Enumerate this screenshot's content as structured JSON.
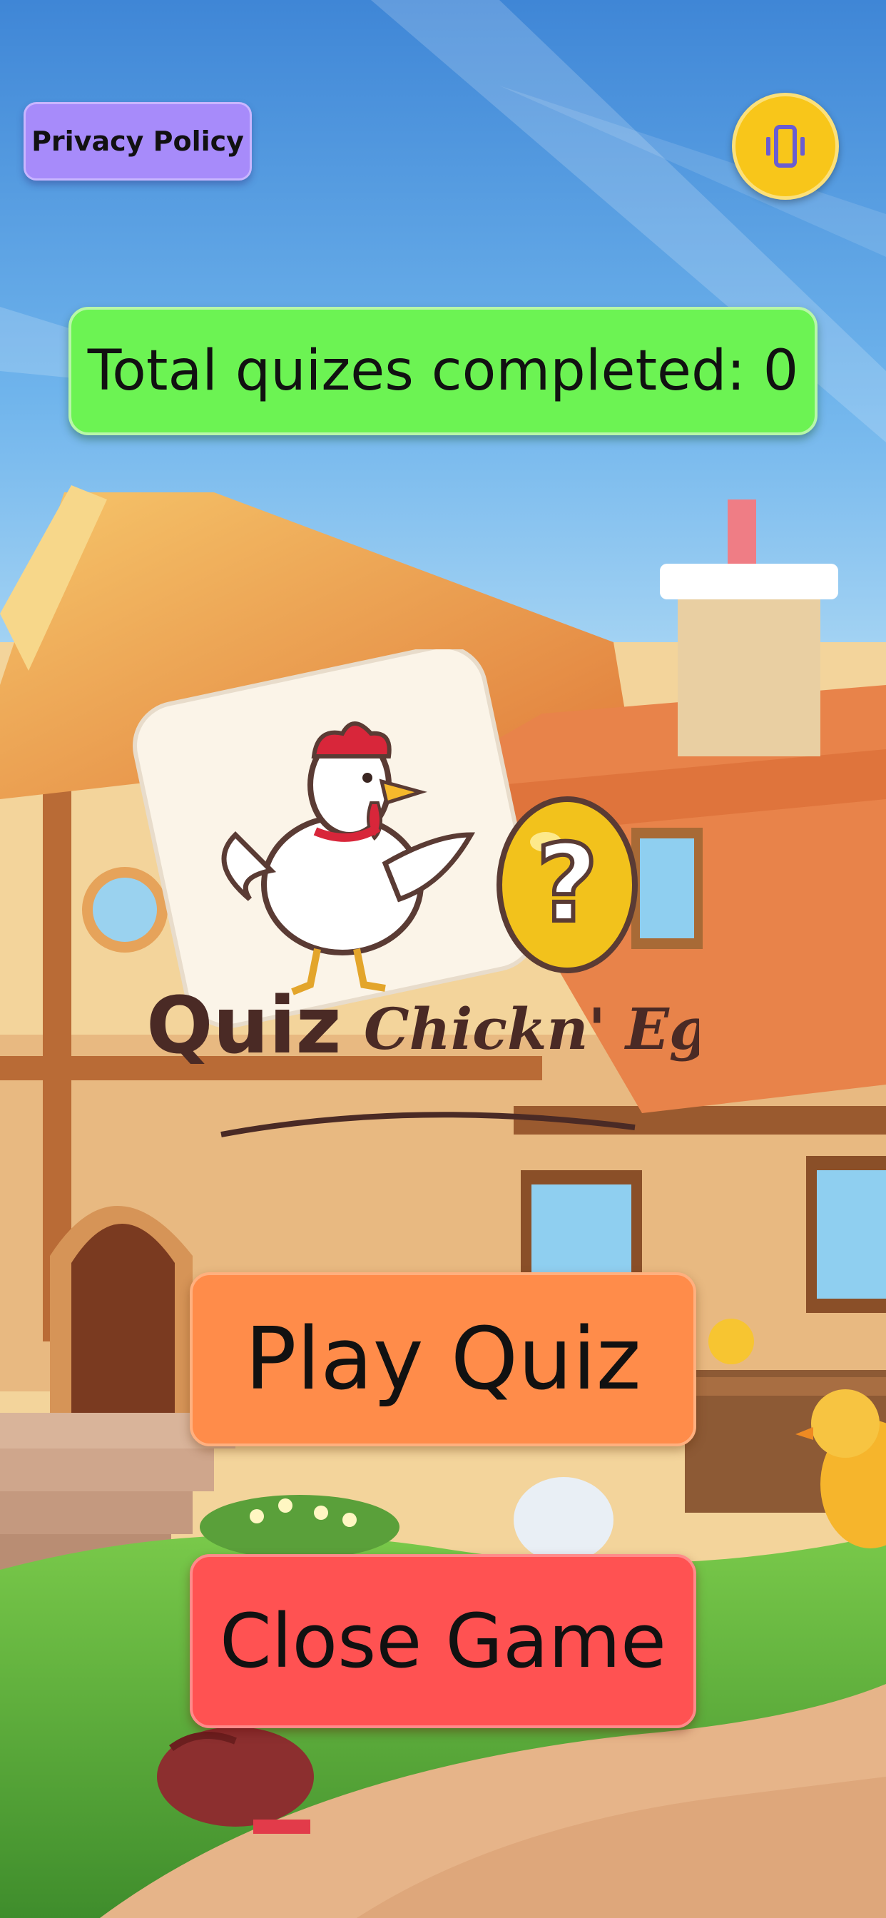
{
  "privacy_button": {
    "label": "Privacy Policy"
  },
  "vibration_button": {
    "icon": "vibrate-phone-icon"
  },
  "counter": {
    "text": "Total quizes completed: 0"
  },
  "logo": {
    "word1": "Quiz",
    "word2": "Chickn' Eggs",
    "egg_symbol": "?"
  },
  "menu": {
    "play_label": "Play Quiz",
    "close_label": "Close Game"
  },
  "colors": {
    "privacy_bg": "#a78bfa",
    "vibrate_bg": "#f8c61a",
    "counter_bg": "#6cf353",
    "play_bg": "#ff8c4a",
    "close_bg": "#ff5252"
  }
}
